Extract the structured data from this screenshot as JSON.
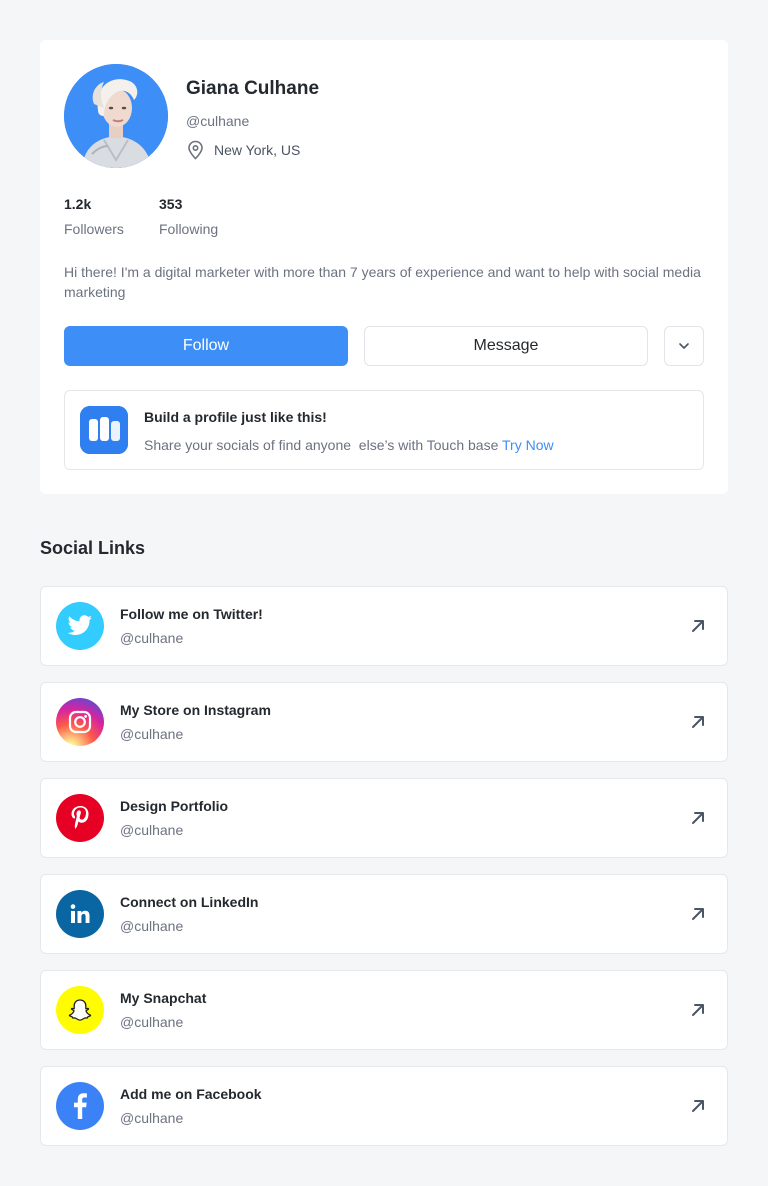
{
  "profile": {
    "name": "Giana Culhane",
    "handle": "@culhane",
    "location": "New York, US",
    "stats": {
      "followers_value": "1.2k",
      "followers_label": "Followers",
      "following_value": "353",
      "following_label": "Following"
    },
    "bio": "Hi there! I'm a digital marketer with more than 7 years of experience and want to help with social media marketing",
    "actions": {
      "follow_label": "Follow",
      "message_label": "Message"
    },
    "promo": {
      "title": "Build a profile just like this!",
      "text": "Share your socials of find anyone  else’s with Touch base ",
      "link": "Try Now"
    }
  },
  "social": {
    "title": "Social Links",
    "items": [
      {
        "title": "Follow me on Twitter!",
        "handle": "@culhane",
        "icon": "twitter-icon",
        "color": "#33ccff"
      },
      {
        "title": "My Store on Instagram",
        "handle": "@culhane",
        "icon": "instagram-icon",
        "color": "#c13584"
      },
      {
        "title": "Design Portfolio",
        "handle": "@culhane",
        "icon": "pinterest-icon",
        "color": "#e60023"
      },
      {
        "title": "Connect on LinkedIn",
        "handle": "@culhane",
        "icon": "linkedin-icon",
        "color": "#0a66a2"
      },
      {
        "title": "My Snapchat",
        "handle": "@culhane",
        "icon": "snapchat-icon",
        "color": "#fffc00"
      },
      {
        "title": "Add me on Facebook",
        "handle": "@culhane",
        "icon": "facebook-icon",
        "color": "#3b82f6"
      }
    ]
  },
  "colors": {
    "accent": "#3e8ef7",
    "background": "#f5f6f8"
  }
}
